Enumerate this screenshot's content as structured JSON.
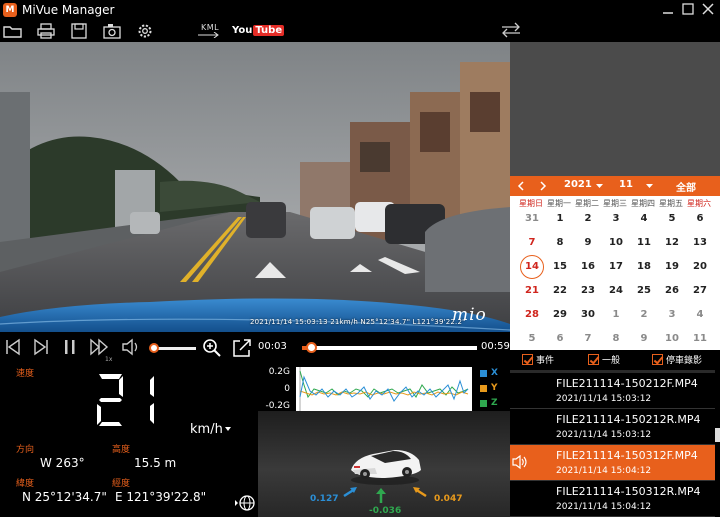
{
  "window": {
    "title": "MiVue Manager",
    "logo_letter": "M"
  },
  "toolbar": {
    "kml_label": "KML",
    "youtube_you": "You",
    "youtube_tube": "Tube"
  },
  "video": {
    "overlay_text": "2021/11/14  15:03:13  21km/h   N25°12'34.7\"  L121°39'22.2\"",
    "brand": "mio"
  },
  "player": {
    "current_time": "00:03",
    "total_time": "00:59",
    "progress": 0.05,
    "volume": 0.0,
    "speed_label": "1x"
  },
  "calendar": {
    "year": "2021",
    "month": "11",
    "all_label": "全部",
    "weekdays": [
      "星期日",
      "星期一",
      "星期二",
      "星期三",
      "星期四",
      "星期五",
      "星期六"
    ],
    "weeks": [
      [
        {
          "d": "31",
          "o": true
        },
        {
          "d": "1"
        },
        {
          "d": "2"
        },
        {
          "d": "3"
        },
        {
          "d": "4"
        },
        {
          "d": "5"
        },
        {
          "d": "6"
        }
      ],
      [
        {
          "d": "7"
        },
        {
          "d": "8"
        },
        {
          "d": "9"
        },
        {
          "d": "10"
        },
        {
          "d": "11"
        },
        {
          "d": "12"
        },
        {
          "d": "13"
        }
      ],
      [
        {
          "d": "14",
          "t": true
        },
        {
          "d": "15"
        },
        {
          "d": "16"
        },
        {
          "d": "17"
        },
        {
          "d": "18"
        },
        {
          "d": "19"
        },
        {
          "d": "20"
        }
      ],
      [
        {
          "d": "21"
        },
        {
          "d": "22"
        },
        {
          "d": "23"
        },
        {
          "d": "24"
        },
        {
          "d": "25"
        },
        {
          "d": "26"
        },
        {
          "d": "27"
        }
      ],
      [
        {
          "d": "28"
        },
        {
          "d": "29"
        },
        {
          "d": "30"
        },
        {
          "d": "1",
          "o": true
        },
        {
          "d": "2",
          "o": true
        },
        {
          "d": "3",
          "o": true
        },
        {
          "d": "4",
          "o": true
        }
      ],
      [
        {
          "d": "5",
          "o": true
        },
        {
          "d": "6",
          "o": true
        },
        {
          "d": "7",
          "o": true
        },
        {
          "d": "8",
          "o": true
        },
        {
          "d": "9",
          "o": true
        },
        {
          "d": "10",
          "o": true
        },
        {
          "d": "11",
          "o": true
        }
      ]
    ]
  },
  "filters": {
    "event": "事件",
    "normal": "一般",
    "parking": "停車錄影"
  },
  "files": [
    {
      "name": "FILE211114-150212F.MP4",
      "time": "2021/11/14   15:03:12",
      "active": false
    },
    {
      "name": "FILE211114-150212R.MP4",
      "time": "2021/11/14   15:03:12",
      "active": false
    },
    {
      "name": "FILE211114-150312F.MP4",
      "time": "2021/11/14   15:04:12",
      "active": true
    },
    {
      "name": "FILE211114-150312R.MP4",
      "time": "2021/11/14   15:04:12",
      "active": false
    }
  ],
  "info": {
    "speed_label": "速度",
    "speed": "21",
    "speed_unit": "km/h",
    "direction_label": "方向",
    "direction": "W 263°",
    "altitude_label": "高度",
    "altitude": "15.5  m",
    "latitude_label": "緯度",
    "latitude": "N 25°12'34.7\"",
    "longitude_label": "經度",
    "longitude": "E 121°39'22.8\""
  },
  "gsensor": {
    "ticks": [
      "0.2G",
      "0",
      "-0.2G"
    ],
    "legend": [
      {
        "name": "X",
        "color": "#2b8fd6"
      },
      {
        "name": "Y",
        "color": "#e89a1c"
      },
      {
        "name": "Z",
        "color": "#2fa84f"
      }
    ],
    "x_value": "0.127",
    "y_value": "0.047",
    "z_value": "-0.036"
  },
  "colors": {
    "accent": "#e8601c",
    "x": "#2b8fd6",
    "y": "#e89a1c",
    "z": "#2fa84f"
  }
}
